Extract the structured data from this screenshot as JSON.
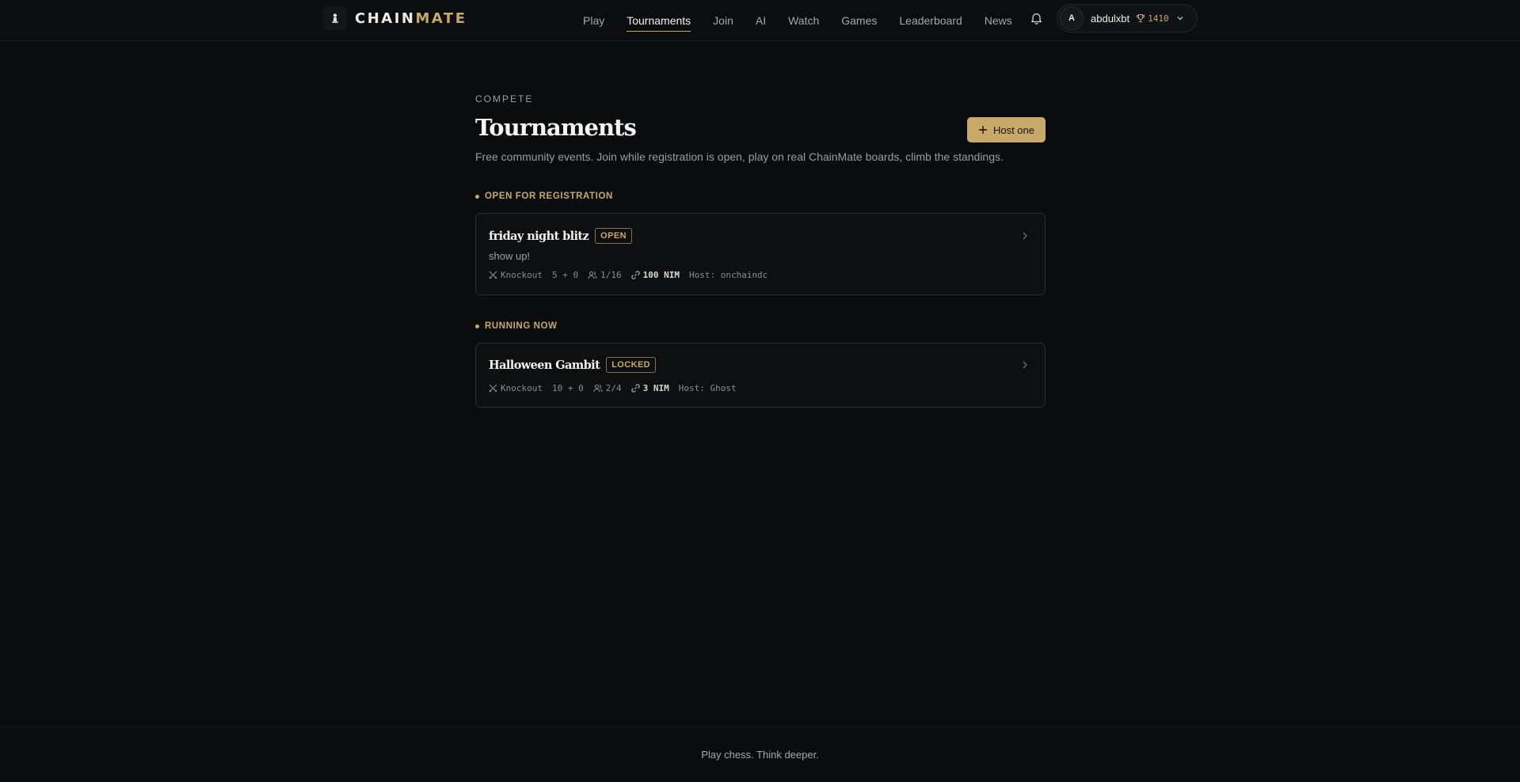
{
  "brand": {
    "name_part1": "CHAIN",
    "name_part2": "MATE",
    "logo_icon": "chess-pawn-logo"
  },
  "nav": {
    "items": [
      {
        "label": "Play",
        "active": false
      },
      {
        "label": "Tournaments",
        "active": true
      },
      {
        "label": "Join",
        "active": false
      },
      {
        "label": "AI",
        "active": false
      },
      {
        "label": "Watch",
        "active": false
      },
      {
        "label": "Games",
        "active": false
      },
      {
        "label": "Leaderboard",
        "active": false
      },
      {
        "label": "News",
        "active": false
      }
    ]
  },
  "user": {
    "avatar_initial": "A",
    "username": "abdulxbt",
    "rating": "1410",
    "rating_icon": "trophy-icon"
  },
  "page": {
    "eyebrow": "COMPETE",
    "title": "Tournaments",
    "host_button": "Host one",
    "subtitle": "Free community events. Join while registration is open, play on real ChainMate boards, climb the standings."
  },
  "sections": [
    {
      "heading": "OPEN FOR REGISTRATION",
      "tournaments": [
        {
          "name": "friday night blitz",
          "status": "OPEN",
          "description": "show up!",
          "format": "Knockout",
          "time_control": "5 + 0",
          "players": "1/16",
          "prize": "100 NIM",
          "host": "Host: onchaindc"
        }
      ]
    },
    {
      "heading": "RUNNING NOW",
      "tournaments": [
        {
          "name": "Halloween Gambit",
          "status": "LOCKED",
          "format": "Knockout",
          "time_control": "10 + 0",
          "players": "2/4",
          "prize": "3 NIM",
          "host": "Host: Ghost"
        }
      ]
    }
  ],
  "footer": {
    "tagline": "Play chess. Think deeper."
  },
  "colors": {
    "accent": "#c9a96a",
    "background": "#0b0c0e",
    "card": "#0e0f11"
  }
}
